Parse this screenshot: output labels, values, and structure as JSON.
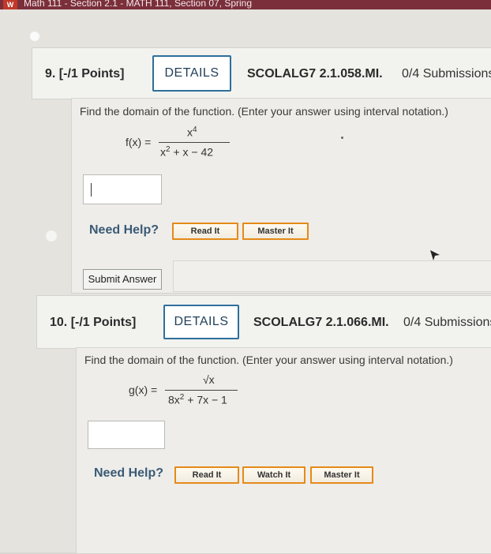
{
  "browser": {
    "tab_text": "Math 111 - Section 2.1 - MATH 111, Section 07, Spring"
  },
  "questions": [
    {
      "number": "9. [-/1 Points]",
      "details_label": "DETAILS",
      "code": "SCOLALG7 2.1.058.MI.",
      "submissions": "0/4 Submissions",
      "prompt": "Find the domain of the function. (Enter your answer using interval notation.)",
      "function_lhs": "f(x) =",
      "numerator": "x4",
      "denominator": "x2 + x − 42",
      "answer_value": "",
      "need_help": "Need Help?",
      "help_buttons": [
        "Read It",
        "Master It"
      ],
      "submit_label": "Submit Answer"
    },
    {
      "number": "10. [-/1 Points]",
      "details_label": "DETAILS",
      "code": "SCOLALG7 2.1.066.MI.",
      "submissions": "0/4 Submissions",
      "prompt": "Find the domain of the function. (Enter your answer using interval notation.)",
      "function_lhs": "g(x) =",
      "numerator": "√x",
      "denominator": "8x2 + 7x − 1",
      "answer_value": "",
      "need_help": "Need Help?",
      "help_buttons": [
        "Read It",
        "Watch It",
        "Master It"
      ]
    }
  ],
  "colors": {
    "accent": "#2e6f9c",
    "help_border": "#e58a18",
    "need_help": "#3a5a75"
  }
}
